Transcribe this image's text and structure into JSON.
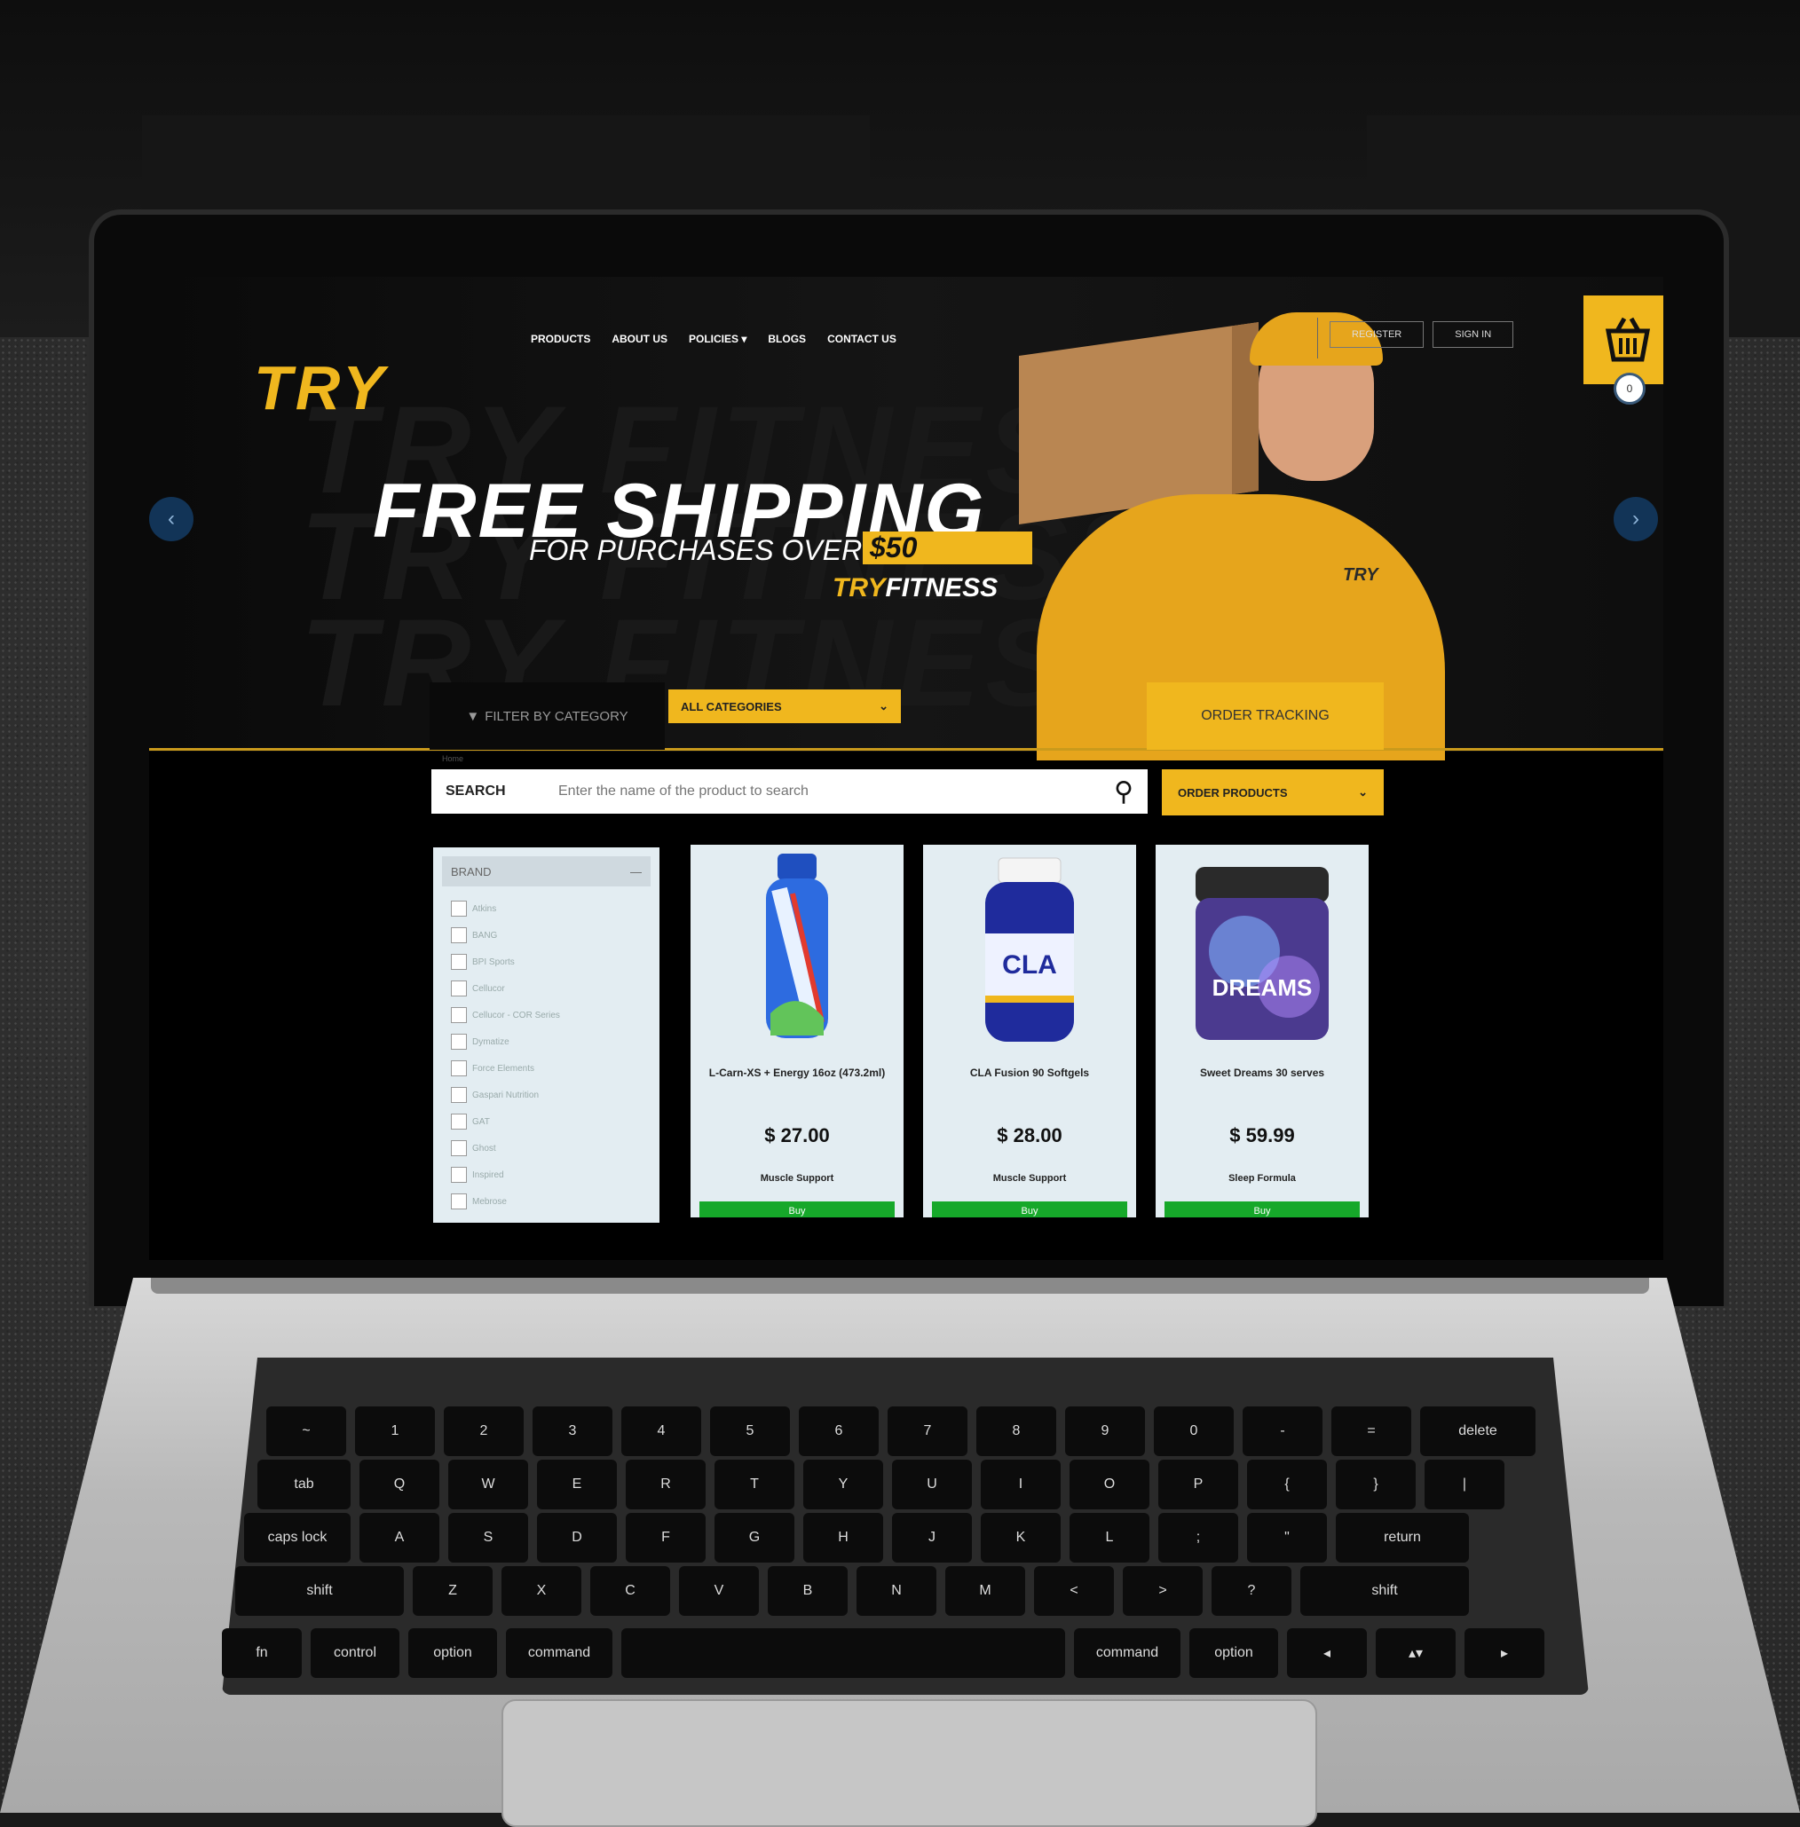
{
  "nav": {
    "logo": "TRY",
    "links": [
      "PRODUCTS",
      "ABOUT US",
      "POLICIES ▾",
      "BLOGS",
      "CONTACT US"
    ],
    "register": "REGISTER",
    "sign_in": "SIGN IN",
    "cart_count": "0"
  },
  "hero": {
    "title": "FREE SHIPPING",
    "subtitle": "FOR PURCHASES OVER",
    "amount": "$50",
    "brand_a": "TRY",
    "brand_b": "FITNESS",
    "shirt_logo": "TRY",
    "prev": "‹",
    "next": "›"
  },
  "filters": {
    "filter_label": "FILTER BY CATEGORY",
    "category_value": "ALL CATEGORIES",
    "order_tracking": "ORDER TRACKING",
    "breadcrumb": "Home"
  },
  "search": {
    "label": "SEARCH",
    "placeholder": "Enter the name of the product to search",
    "order_products": "ORDER PRODUCTS"
  },
  "brand_filter": {
    "title": "BRAND",
    "toggle": "—",
    "items": [
      "Atkins",
      "BANG",
      "BPI Sports",
      "Cellucor",
      "Cellucor - COR Series",
      "Dymatize",
      "Force Elements",
      "Gaspari Nutrition",
      "GAT",
      "Ghost",
      "Inspired",
      "Mebrose"
    ]
  },
  "products": [
    {
      "name": "L-Carn-XS + Energy 16oz (473.2ml)",
      "price": "$ 27.00",
      "category": "Muscle Support",
      "buy": "Buy"
    },
    {
      "name": "CLA Fusion 90 Softgels",
      "price": "$ 28.00",
      "category": "Muscle Support",
      "buy": "Buy"
    },
    {
      "name": "Sweet Dreams 30 serves",
      "price": "$ 59.99",
      "category": "Sleep Formula",
      "buy": "Buy"
    }
  ],
  "keyboard": {
    "row1": [
      "~",
      "1",
      "2",
      "3",
      "4",
      "5",
      "6",
      "7",
      "8",
      "9",
      "0",
      "-",
      "=",
      "delete"
    ],
    "row2": [
      "tab",
      "Q",
      "W",
      "E",
      "R",
      "T",
      "Y",
      "U",
      "I",
      "O",
      "P",
      "{",
      "}",
      "|"
    ],
    "row3": [
      "caps lock",
      "A",
      "S",
      "D",
      "F",
      "G",
      "H",
      "J",
      "K",
      "L",
      ";",
      "\"",
      "return"
    ],
    "row4": [
      "shift",
      "Z",
      "X",
      "C",
      "V",
      "B",
      "N",
      "M",
      "<",
      ">",
      "?",
      "shift"
    ],
    "row5": [
      "fn",
      "control",
      "option",
      "command",
      "",
      "command",
      "option",
      "◂",
      "▴▾",
      "▸"
    ]
  },
  "colors": {
    "accent": "#f0b71e",
    "buy": "#16a82a",
    "panel": "#e3edf2"
  }
}
